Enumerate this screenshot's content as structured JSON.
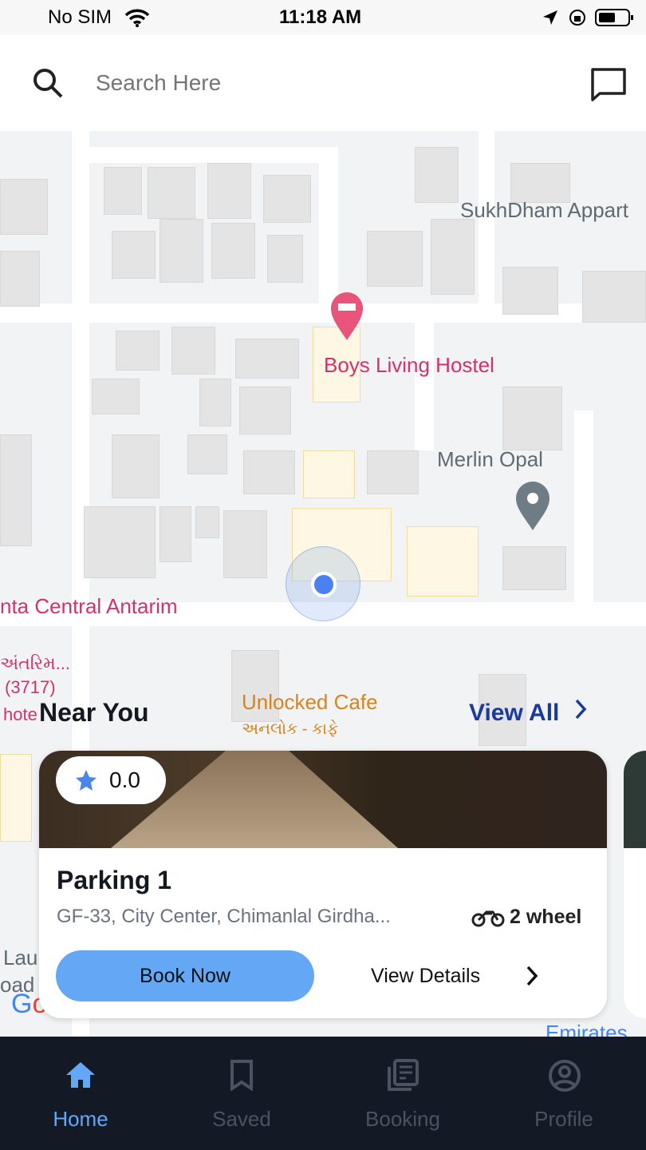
{
  "status": {
    "carrier": "No SIM",
    "time": "11:18 AM"
  },
  "search": {
    "placeholder": "Search Here"
  },
  "map": {
    "labels": [
      {
        "text": "SukhDham Appart",
        "color": "#5f6b73"
      },
      {
        "text": "Boys Living Hostel",
        "color": "#d6306a"
      },
      {
        "text": "Merlin Opal",
        "color": "#5f6b73"
      },
      {
        "text": "nta Central Antarim",
        "color": "#d6306a"
      },
      {
        "text": "Unlocked Cafe",
        "color": "#d9831a"
      },
      {
        "text": "અનલોક - કાફે",
        "color": "#d9831a"
      },
      {
        "text": "અંતરિમ...",
        "color": "#d6306a"
      },
      {
        "text": "(3717)",
        "color": "#d6306a"
      },
      {
        "text": "hote",
        "color": "#d6306a"
      },
      {
        "text": "Lau",
        "color": "#5f6b73"
      },
      {
        "text": "oad",
        "color": "#5f6b73"
      },
      {
        "text": "Emirates",
        "color": "#4285f4"
      }
    ]
  },
  "section": {
    "title": "Near You",
    "view_all": "View All"
  },
  "card": {
    "rating": "0.0",
    "name": "Parking 1",
    "address": "GF-33, City Center, Chimanlal Girdha...",
    "vehicle": "2 wheel",
    "book": "Book Now",
    "details": "View Details"
  },
  "nav": [
    {
      "label": "Home",
      "active": true
    },
    {
      "label": "Saved"
    },
    {
      "label": "Booking"
    },
    {
      "label": "Profile"
    }
  ],
  "colors": {
    "accent": "#64a8f5",
    "nav_bg": "#131a26",
    "view_all": "#1a3a9c"
  }
}
